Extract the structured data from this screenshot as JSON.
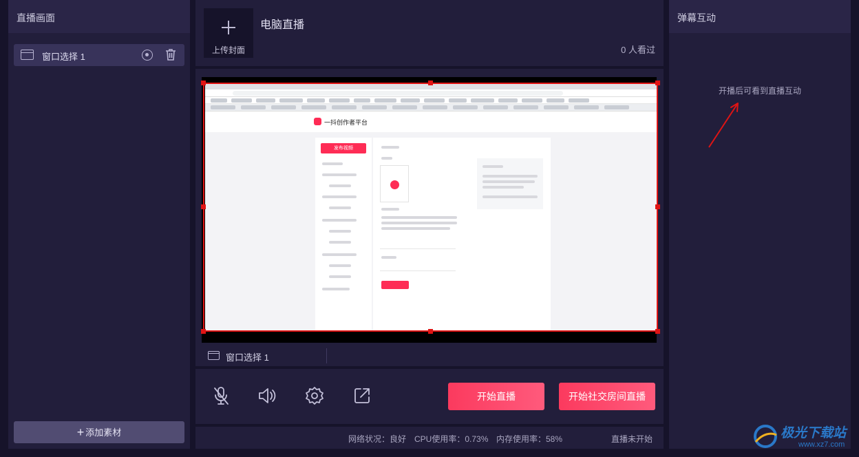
{
  "left_panel": {
    "title": "直播画面",
    "sources": [
      {
        "label": "窗口选择 1"
      }
    ],
    "add_button": "添加素材"
  },
  "top_panel": {
    "upload_cover": "上传封面",
    "live_title": "电脑直播",
    "viewers": "0 人看过"
  },
  "preview": {
    "source_label": "窗口选择 1",
    "screenshot": {
      "site_name": "一抖创作者平台",
      "publish_button": "发布视频"
    }
  },
  "controls": {
    "icons": [
      "microphone-muted-icon",
      "speaker-icon",
      "settings-gear-icon",
      "popout-icon"
    ],
    "start_live": "开始直播",
    "start_social_live": "开始社交房间直播"
  },
  "status_bar": {
    "network": "网络状况：良好",
    "cpu": "CPU使用率：0.73%",
    "memory": "内存使用率：58%",
    "live_state": "直播未开始"
  },
  "right_panel": {
    "title": "弹幕互动",
    "hint": "开播后可看到直播互动"
  },
  "watermark": {
    "brand": "极光下载站",
    "url": "www.xz7.com"
  },
  "colors": {
    "background": "#16132a",
    "panel": "#221e3b",
    "accent": "#fb3a5e",
    "selection": "#e01414"
  }
}
